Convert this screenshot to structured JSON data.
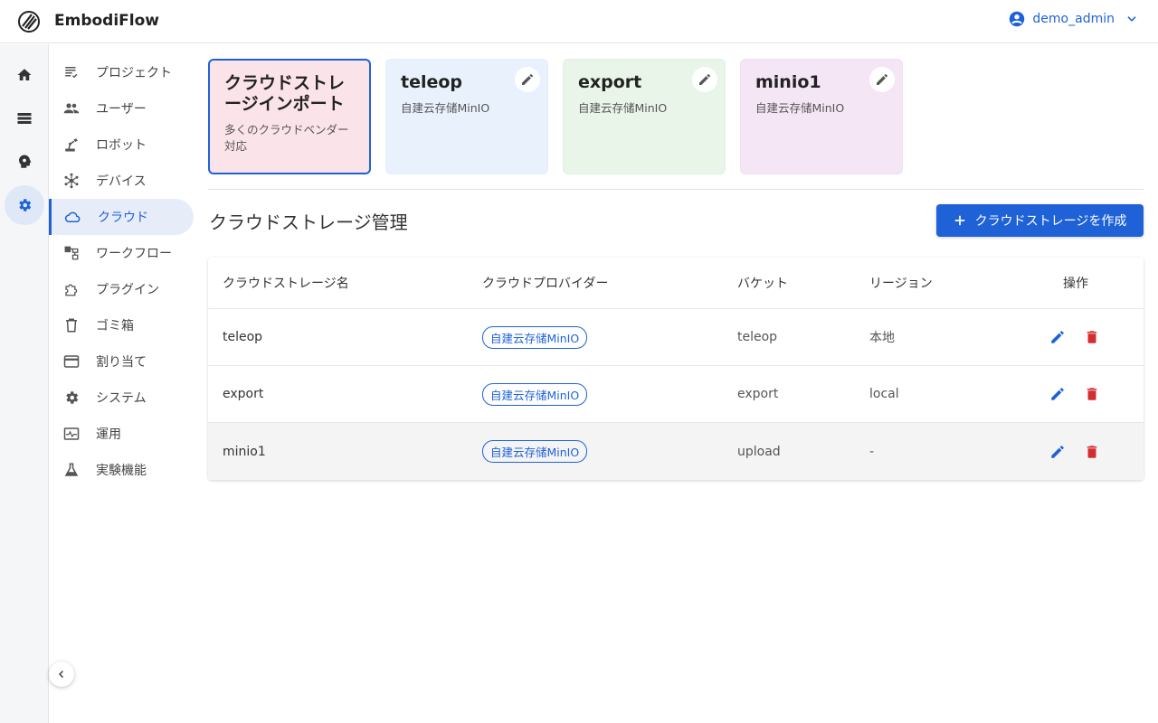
{
  "app": {
    "title": "EmbodiFlow"
  },
  "user": {
    "name": "demo_admin"
  },
  "sidebar": {
    "items": [
      {
        "label": "プロジェクト",
        "icon": "project-list-icon"
      },
      {
        "label": "ユーザー",
        "icon": "users-icon"
      },
      {
        "label": "ロボット",
        "icon": "robot-arm-icon"
      },
      {
        "label": "デバイス",
        "icon": "device-hub-icon"
      },
      {
        "label": "クラウド",
        "icon": "cloud-icon",
        "active": true
      },
      {
        "label": "ワークフロー",
        "icon": "workflow-icon"
      },
      {
        "label": "プラグイン",
        "icon": "plugin-icon"
      },
      {
        "label": "ゴミ箱",
        "icon": "trash-icon"
      },
      {
        "label": "割り当て",
        "icon": "card-icon"
      },
      {
        "label": "システム",
        "icon": "gear-icon"
      },
      {
        "label": "運用",
        "icon": "monitor-icon"
      },
      {
        "label": "実験機能",
        "icon": "flask-icon"
      }
    ]
  },
  "cards": [
    {
      "title": "クラウドストレージインポート",
      "subtitle": "多くのクラウドベンダー対応",
      "color": "#fbe3ea",
      "border": "#1f62d8"
    },
    {
      "title": "teleop",
      "subtitle": "自建云存储MinIO",
      "color": "#e9f2fc"
    },
    {
      "title": "export",
      "subtitle": "自建云存储MinIO",
      "color": "#eaf5ea"
    },
    {
      "title": "minio1",
      "subtitle": "自建云存储MinIO",
      "color": "#f4e6f5"
    }
  ],
  "main": {
    "title": "クラウドストレージ管理",
    "create_label": "クラウドストレージを作成"
  },
  "table": {
    "headers": [
      "クラウドストレージ名",
      "クラウドプロバイダー",
      "バケット",
      "リージョン",
      "操作"
    ],
    "rows": [
      {
        "name": "teleop",
        "provider": "自建云存储MinIO",
        "bucket": "teleop",
        "region": "本地"
      },
      {
        "name": "export",
        "provider": "自建云存储MinIO",
        "bucket": "export",
        "region": "local"
      },
      {
        "name": "minio1",
        "provider": "自建云存储MinIO",
        "bucket": "upload",
        "region": "-"
      }
    ]
  },
  "colors": {
    "accent": "#1f62d8",
    "danger": "#d32f2f"
  }
}
